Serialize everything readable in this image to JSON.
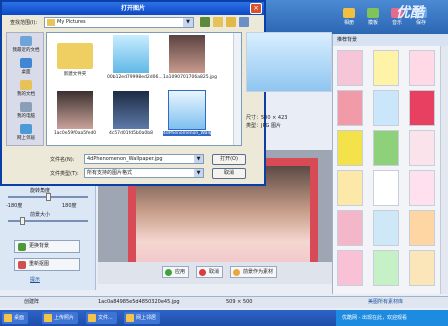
{
  "dialog": {
    "title": "打开图片",
    "look_in_label": "查找范围(I):",
    "look_in_value": "My Pictures",
    "places": [
      "我最近的文档",
      "桌面",
      "我的文档",
      "我的电脑",
      "网上邻居"
    ],
    "files": [
      {
        "name": "新建文件夹",
        "kind": "folder"
      },
      {
        "name": "00b12ed79998ed2d06...",
        "kind": "image"
      },
      {
        "name": "1a1090701706a825.jpg",
        "kind": "image"
      },
      {
        "name": "1ac0e59f0aa5fed0",
        "kind": "image"
      },
      {
        "name": "4c57d01fd5b0a0b8",
        "kind": "image"
      },
      {
        "name": "4dPhenomenon_Wallpaper.jpg",
        "kind": "image",
        "selected": true
      }
    ],
    "preview_size": "尺寸：500 × 423",
    "preview_type": "类型：JPG 图片",
    "filename_label": "文件名(N):",
    "filename_value": "4dPhenomenon_Wallpaper.jpg",
    "filetype_label": "文件类型(T):",
    "filetype_value": "所有支持的图片格式",
    "open_button": "打开(O)",
    "cancel_button": "取消"
  },
  "app": {
    "logo": "优酷",
    "tabs": [
      "相册",
      "模板",
      "音乐",
      "保存"
    ],
    "right_title": "推荐背景",
    "left_labels": {
      "slider1": "旋转角度",
      "range_min": "-180度",
      "range_max": "180度",
      "slider2": "前景大小",
      "btn_change": "更换背景",
      "btn_reset": "重新抠图",
      "tips": "提示"
    },
    "bottom_buttons": [
      "应用",
      "取消",
      "前景作为素材"
    ],
    "status_filename": "1ac0a84985e5d4850320e45.jpg",
    "status_size": "509 × 500",
    "status_left": "创建阵",
    "status_right": "美图所有素材库"
  },
  "taskbar": {
    "items": [
      "桌面",
      "上传照片",
      "文件...",
      "网上邻居"
    ],
    "tray_text": "优酷网 - 出现在此，欢迎观看"
  }
}
